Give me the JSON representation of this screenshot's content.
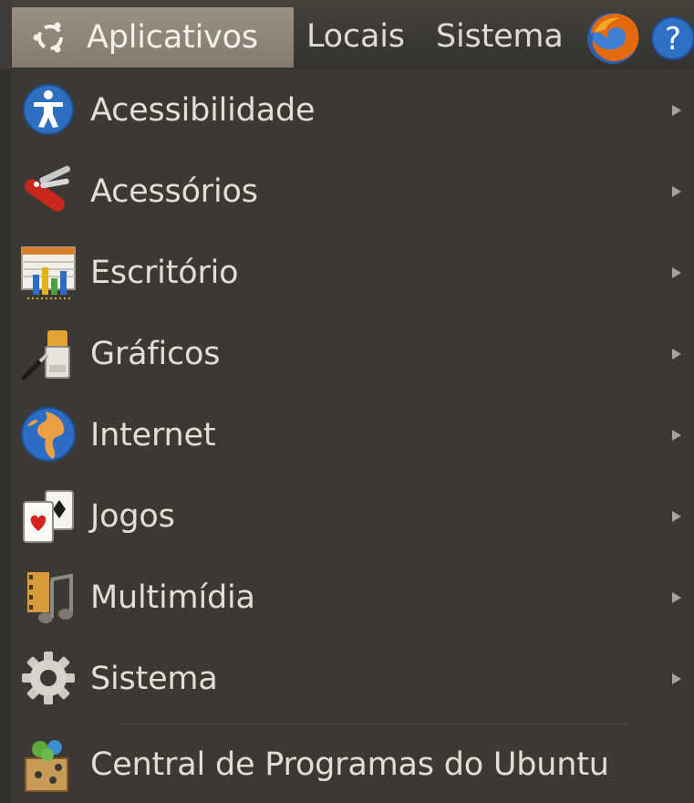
{
  "panel": {
    "applications_label": "Aplicativos",
    "places_label": "Locais",
    "system_label": "Sistema",
    "launchers": [
      {
        "icon": "firefox-icon"
      },
      {
        "icon": "help-icon",
        "glyph": "?"
      }
    ]
  },
  "menu": {
    "items": [
      {
        "label": "Acessibilidade",
        "icon": "accessibility-icon",
        "has_submenu": true
      },
      {
        "label": "Acessórios",
        "icon": "accessories-icon",
        "has_submenu": true
      },
      {
        "label": "Escritório",
        "icon": "office-icon",
        "has_submenu": true
      },
      {
        "label": "Gráficos",
        "icon": "graphics-icon",
        "has_submenu": true
      },
      {
        "label": "Internet",
        "icon": "internet-icon",
        "has_submenu": true
      },
      {
        "label": "Jogos",
        "icon": "games-icon",
        "has_submenu": true
      },
      {
        "label": "Multimídia",
        "icon": "multimedia-icon",
        "has_submenu": true
      },
      {
        "label": "Sistema",
        "icon": "system-gear-icon",
        "has_submenu": true
      }
    ],
    "footer_item": {
      "label": "Central de Programas do Ubuntu",
      "icon": "software-center-icon"
    }
  },
  "colors": {
    "panel_bg": "#3a3834",
    "active_menu_bg": "#8f8577",
    "menu_bg": "#3c3935",
    "text": "#e2ded6"
  }
}
